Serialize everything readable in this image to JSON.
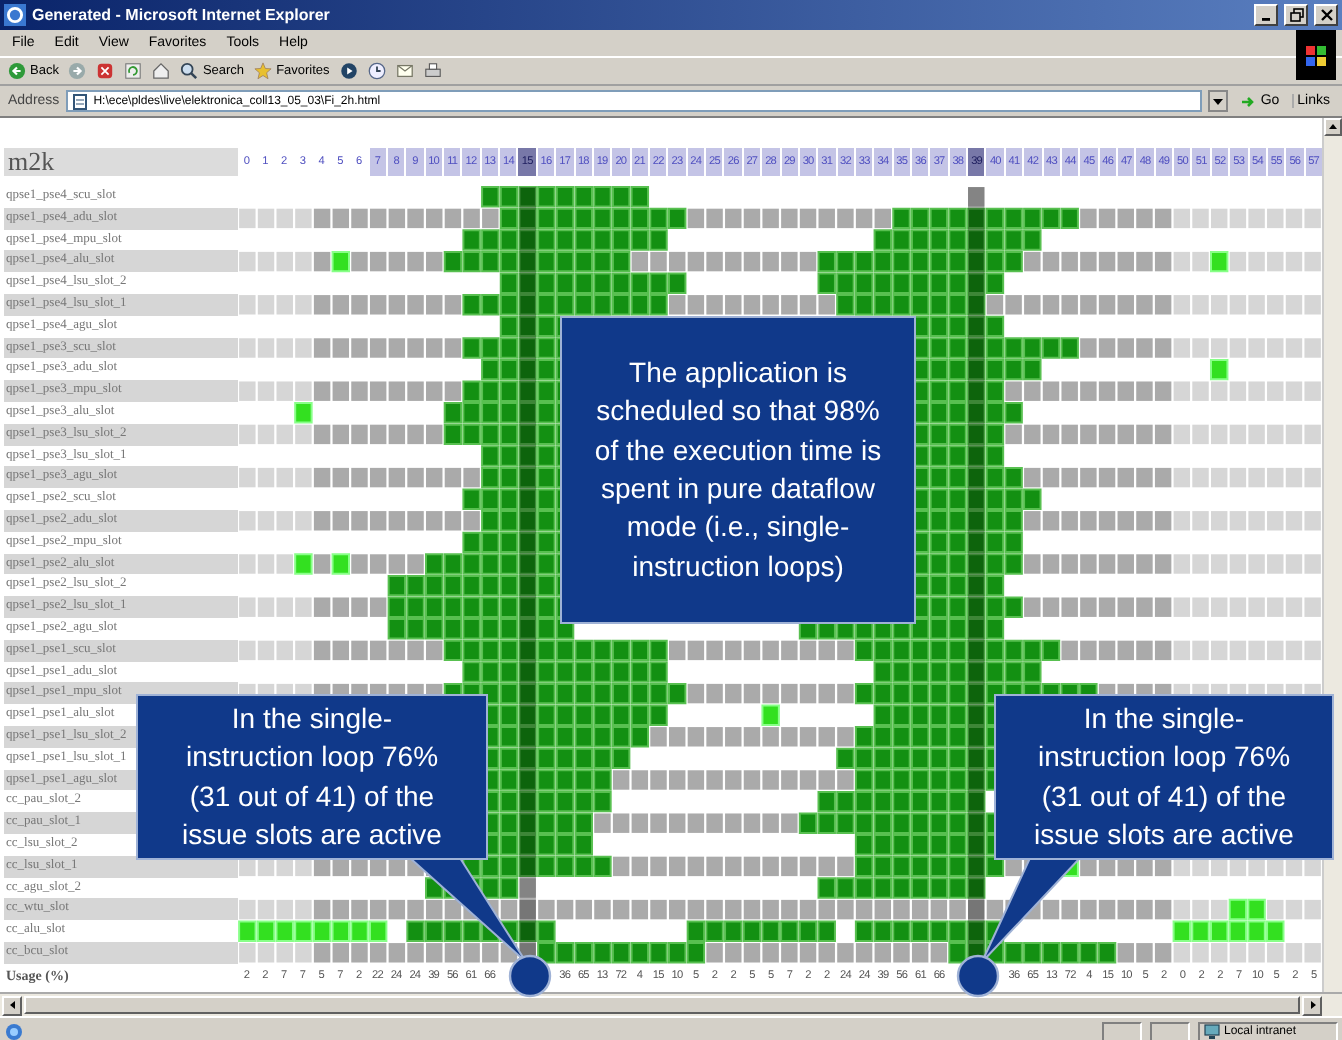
{
  "window": {
    "title": "Generated - Microsoft Internet Explorer"
  },
  "menu": [
    "File",
    "Edit",
    "View",
    "Favorites",
    "Tools",
    "Help"
  ],
  "toolbar": [
    {
      "kind": "back",
      "label": "Back"
    },
    {
      "kind": "forward"
    },
    {
      "kind": "stop"
    },
    {
      "kind": "refresh"
    },
    {
      "kind": "home"
    },
    {
      "kind": "search",
      "label": "Search"
    },
    {
      "kind": "favorites",
      "label": "Favorites"
    },
    {
      "kind": "media"
    },
    {
      "kind": "history"
    },
    {
      "kind": "mail"
    },
    {
      "kind": "print"
    }
  ],
  "address": {
    "label": "Address",
    "value": "H:\\ece\\pldes\\live\\elektronica_coll13_05_03\\Fi_2h.html",
    "go": "Go",
    "links": "Links"
  },
  "grid": {
    "title": "m2k",
    "columns": [
      {
        "label": "0",
        "shaded": false,
        "highlighted": false
      },
      {
        "label": "1",
        "shaded": false,
        "highlighted": false
      },
      {
        "label": "2",
        "shaded": false,
        "highlighted": false
      },
      {
        "label": "3",
        "shaded": false,
        "highlighted": false
      },
      {
        "label": "4",
        "shaded": false,
        "highlighted": false
      },
      {
        "label": "5",
        "shaded": false,
        "highlighted": false
      },
      {
        "label": "6",
        "shaded": false,
        "highlighted": false
      },
      {
        "label": "7",
        "shaded": true,
        "highlighted": false
      },
      {
        "label": "8",
        "shaded": true,
        "highlighted": false
      },
      {
        "label": "9",
        "shaded": true,
        "highlighted": false
      },
      {
        "label": "10",
        "shaded": true,
        "highlighted": false
      },
      {
        "label": "11",
        "shaded": true,
        "highlighted": false
      },
      {
        "label": "12",
        "shaded": true,
        "highlighted": false
      },
      {
        "label": "13",
        "shaded": true,
        "highlighted": false
      },
      {
        "label": "14",
        "shaded": true,
        "highlighted": false
      },
      {
        "label": "15",
        "shaded": true,
        "highlighted": true
      },
      {
        "label": "16",
        "shaded": true,
        "highlighted": false
      },
      {
        "label": "17",
        "shaded": true,
        "highlighted": false
      },
      {
        "label": "18",
        "shaded": true,
        "highlighted": false
      },
      {
        "label": "19",
        "shaded": true,
        "highlighted": false
      },
      {
        "label": "20",
        "shaded": true,
        "highlighted": false
      },
      {
        "label": "21",
        "shaded": true,
        "highlighted": false
      },
      {
        "label": "22",
        "shaded": true,
        "highlighted": false
      },
      {
        "label": "23",
        "shaded": true,
        "highlighted": false
      },
      {
        "label": "24",
        "shaded": true,
        "highlighted": false
      },
      {
        "label": "25",
        "shaded": true,
        "highlighted": false
      },
      {
        "label": "26",
        "shaded": true,
        "highlighted": false
      },
      {
        "label": "27",
        "shaded": true,
        "highlighted": false
      },
      {
        "label": "28",
        "shaded": true,
        "highlighted": false
      },
      {
        "label": "29",
        "shaded": true,
        "highlighted": false
      },
      {
        "label": "30",
        "shaded": true,
        "highlighted": false
      },
      {
        "label": "31",
        "shaded": true,
        "highlighted": false
      },
      {
        "label": "32",
        "shaded": true,
        "highlighted": false
      },
      {
        "label": "33",
        "shaded": true,
        "highlighted": false
      },
      {
        "label": "34",
        "shaded": true,
        "highlighted": false
      },
      {
        "label": "35",
        "shaded": true,
        "highlighted": false
      },
      {
        "label": "36",
        "shaded": true,
        "highlighted": false
      },
      {
        "label": "37",
        "shaded": true,
        "highlighted": false
      },
      {
        "label": "38",
        "shaded": true,
        "highlighted": false
      },
      {
        "label": "39",
        "shaded": true,
        "highlighted": true
      },
      {
        "label": "40",
        "shaded": true,
        "highlighted": false
      },
      {
        "label": "41",
        "shaded": true,
        "highlighted": false
      },
      {
        "label": "42",
        "shaded": true,
        "highlighted": false
      },
      {
        "label": "43",
        "shaded": true,
        "highlighted": false
      },
      {
        "label": "44",
        "shaded": true,
        "highlighted": false
      },
      {
        "label": "45",
        "shaded": true,
        "highlighted": false
      },
      {
        "label": "46",
        "shaded": true,
        "highlighted": false
      },
      {
        "label": "47",
        "shaded": true,
        "highlighted": false
      },
      {
        "label": "48",
        "shaded": true,
        "highlighted": false
      },
      {
        "label": "49",
        "shaded": true,
        "highlighted": false
      },
      {
        "label": "50",
        "shaded": true,
        "highlighted": false
      },
      {
        "label": "51",
        "shaded": true,
        "highlighted": false
      },
      {
        "label": "52",
        "shaded": true,
        "highlighted": false
      },
      {
        "label": "53",
        "shaded": true,
        "highlighted": false
      },
      {
        "label": "54",
        "shaded": true,
        "highlighted": false
      },
      {
        "label": "55",
        "shaded": true,
        "highlighted": false
      },
      {
        "label": "56",
        "shaded": true,
        "highlighted": false
      },
      {
        "label": "57",
        "shaded": true,
        "highlighted": false
      }
    ],
    "rows": [
      {
        "label": "qpse1_pse4_scu_slot",
        "striped": false
      },
      {
        "label": "qpse1_pse4_adu_slot",
        "striped": true
      },
      {
        "label": "qpse1_pse4_mpu_slot",
        "striped": false
      },
      {
        "label": "qpse1_pse4_alu_slot",
        "striped": true
      },
      {
        "label": "qpse1_pse4_lsu_slot_2",
        "striped": false
      },
      {
        "label": "qpse1_pse4_lsu_slot_1",
        "striped": true
      },
      {
        "label": "qpse1_pse4_agu_slot",
        "striped": false
      },
      {
        "label": "qpse1_pse3_scu_slot",
        "striped": true
      },
      {
        "label": "qpse1_pse3_adu_slot",
        "striped": false
      },
      {
        "label": "qpse1_pse3_mpu_slot",
        "striped": true
      },
      {
        "label": "qpse1_pse3_alu_slot",
        "striped": false
      },
      {
        "label": "qpse1_pse3_lsu_slot_2",
        "striped": true
      },
      {
        "label": "qpse1_pse3_lsu_slot_1",
        "striped": false
      },
      {
        "label": "qpse1_pse3_agu_slot",
        "striped": true
      },
      {
        "label": "qpse1_pse2_scu_slot",
        "striped": false
      },
      {
        "label": "qpse1_pse2_adu_slot",
        "striped": true
      },
      {
        "label": "qpse1_pse2_mpu_slot",
        "striped": false
      },
      {
        "label": "qpse1_pse2_alu_slot",
        "striped": true
      },
      {
        "label": "qpse1_pse2_lsu_slot_2",
        "striped": false
      },
      {
        "label": "qpse1_pse2_lsu_slot_1",
        "striped": true
      },
      {
        "label": "qpse1_pse2_agu_slot",
        "striped": false
      },
      {
        "label": "qpse1_pse1_scu_slot",
        "striped": true
      },
      {
        "label": "qpse1_pse1_adu_slot",
        "striped": false
      },
      {
        "label": "qpse1_pse1_mpu_slot",
        "striped": true
      },
      {
        "label": "qpse1_pse1_alu_slot",
        "striped": false
      },
      {
        "label": "qpse1_pse1_lsu_slot_2",
        "striped": true
      },
      {
        "label": "qpse1_pse1_lsu_slot_1",
        "striped": false
      },
      {
        "label": "qpse1_pse1_agu_slot",
        "striped": true
      },
      {
        "label": "cc_pau_slot_2",
        "striped": false
      },
      {
        "label": "cc_pau_slot_1",
        "striped": true
      },
      {
        "label": "cc_lsu_slot_2",
        "striped": false
      },
      {
        "label": "cc_lsu_slot_1",
        "striped": true
      },
      {
        "label": "cc_agu_slot_2",
        "striped": false
      },
      {
        "label": "cc_wtu_slot",
        "striped": true
      },
      {
        "label": "cc_alu_slot",
        "striped": false
      },
      {
        "label": "cc_bcu_slot",
        "striped": true
      }
    ],
    "usage_label": "Usage (%)",
    "usage_segments": [
      [
        "2",
        "2",
        "7",
        "7",
        "5",
        "7",
        "2",
        "22",
        "24",
        "24",
        "39",
        "56",
        "61",
        "66"
      ],
      [
        "36",
        "65",
        "13",
        "72",
        "4",
        "15",
        "10",
        "5",
        "2",
        "2",
        "5",
        "5",
        "7",
        "2",
        "2",
        "24",
        "24",
        "39",
        "56",
        "61",
        "66"
      ],
      [
        "36",
        "65",
        "13",
        "72",
        "4",
        "15",
        "10",
        "5",
        "2",
        "0",
        "2",
        "2",
        "7",
        "10",
        "5",
        "2",
        "5"
      ]
    ]
  },
  "callouts": [
    {
      "text": "The application is scheduled so that 98% of the execution time is spent in pure dataflow mode (i.e., single-instruction loops)",
      "pointer": false
    },
    {
      "text": "In the single-instruction loop 76% (31 out of 41) of the issue slots are active",
      "pointer": true
    },
    {
      "text": "In the single-instruction loop 76% (31 out of 41) of the issue slots are active",
      "pointer": true
    }
  ],
  "status_bar": {
    "zone": "Local intranet"
  }
}
